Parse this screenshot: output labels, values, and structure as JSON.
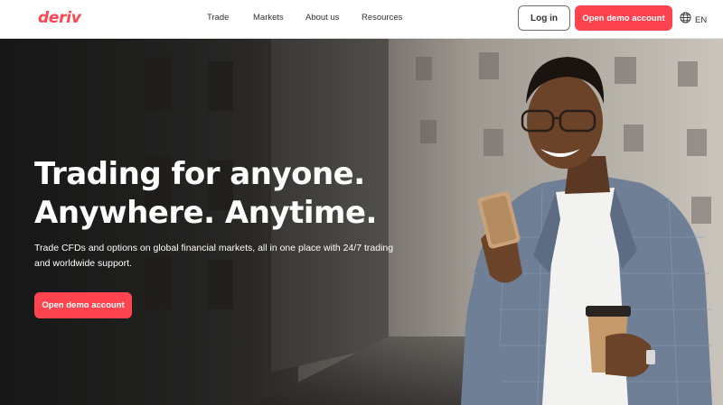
{
  "header": {
    "logo": "deriv",
    "nav": [
      {
        "label": "Trade"
      },
      {
        "label": "Markets"
      },
      {
        "label": "About us"
      },
      {
        "label": "Resources"
      }
    ],
    "login_label": "Log in",
    "demo_label": "Open demo account",
    "language": "EN",
    "language_icon": "globe-icon"
  },
  "hero": {
    "title_line1": "Trading for anyone.",
    "title_line2": "Anywhere. Anytime.",
    "subtitle_line1": "Trade CFDs and options on global financial markets, all in one place with 24/7 trading",
    "subtitle_line2": "and worldwide support.",
    "cta_label": "Open demo account"
  },
  "colors": {
    "brand": "#ff444f",
    "text_dark": "#333333",
    "hero_text": "#ffffff"
  }
}
